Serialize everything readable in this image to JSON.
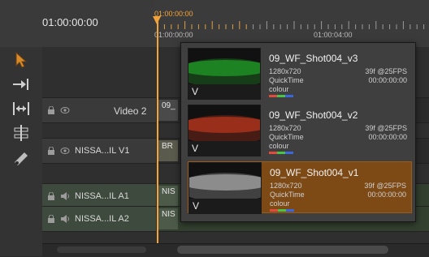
{
  "header": {
    "sequence_timecode": "01:00:00:00",
    "ruler_playhead_time": "01:00:00:00",
    "ruler_start_time": "01:00:00:00",
    "ruler_next_time": "01:00:04:00"
  },
  "tools": [
    {
      "icon": "selection-arrow-icon"
    },
    {
      "icon": "track-select-forward-icon"
    },
    {
      "icon": "ripple-edit-icon"
    },
    {
      "icon": "rolling-edit-icon"
    },
    {
      "icon": "razor-tool-icon"
    }
  ],
  "tracks": {
    "video2": {
      "label": "Video 2",
      "clip": "09_"
    },
    "v1": {
      "label": "NISSA...IL V1",
      "clip": "BR"
    },
    "a1": {
      "label": "NISSA...IL A1",
      "clip": "NIS"
    },
    "a2": {
      "label": "NISSA...IL A2",
      "clip": "NIS"
    }
  },
  "versions": [
    {
      "name": "09_WF_Shot004_v3",
      "resolution": "1280x720",
      "format": "QuickTime",
      "color": "colour",
      "frames": "39f @25FPS",
      "timecode": "00:00:00:00",
      "thumb_tint": "#1f8f24",
      "selected": false
    },
    {
      "name": "09_WF_Shot004_v2",
      "resolution": "1280x720",
      "format": "QuickTime",
      "color": "colour",
      "frames": "39f @25FPS",
      "timecode": "00:00:00:00",
      "thumb_tint": "#a8321c",
      "selected": false
    },
    {
      "name": "09_WF_Shot004_v1",
      "resolution": "1280x720",
      "format": "QuickTime",
      "color": "colour",
      "frames": "39f @25FPS",
      "timecode": "00:00:00:00",
      "thumb_tint": "#9a9a9a",
      "selected": true
    }
  ],
  "thumb_label": "V",
  "colors": {
    "accent": "#f2a33a",
    "selected_bg": "#7d4a16"
  }
}
